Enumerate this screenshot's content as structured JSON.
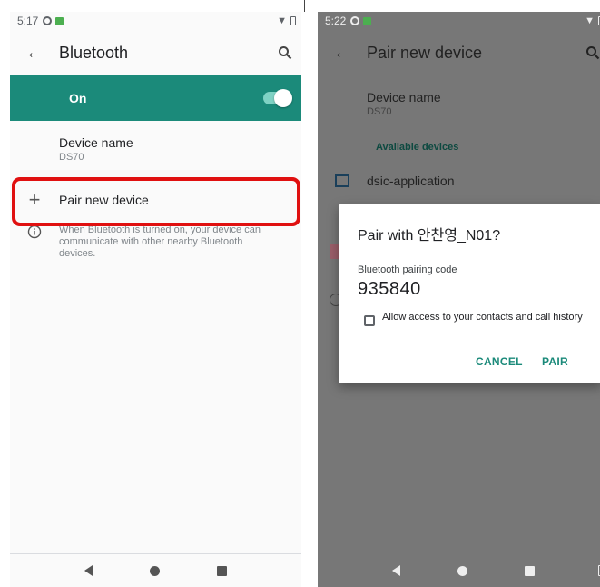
{
  "left": {
    "status_time": "5:17",
    "title": "Bluetooth",
    "toggle_label": "On",
    "device_name_title": "Device name",
    "device_name_value": "DS70",
    "pair_label": "Pair new device",
    "info_text": "When Bluetooth is turned on, your device can communicate with other nearby Bluetooth devices."
  },
  "right": {
    "status_time": "5:22",
    "title": "Pair new device",
    "device_name_title": "Device name",
    "device_name_value": "DS70",
    "available_header": "Available devices",
    "device_item": "dsic-application",
    "dialog": {
      "title": "Pair with 안찬영_N01?",
      "code_label": "Bluetooth pairing code",
      "code": "935840",
      "checkbox_label": "Allow access to your contacts and call history",
      "cancel_label": "CANCEL",
      "pair_label": "PAIR"
    }
  },
  "colors": {
    "accent": "#1b8a7a",
    "highlight": "#e01010",
    "scrim": "#777777"
  },
  "icons": [
    "back-arrow-icon",
    "search-icon",
    "plus-icon",
    "info-icon",
    "nav-back-icon",
    "nav-home-icon",
    "nav-recents-icon"
  ]
}
